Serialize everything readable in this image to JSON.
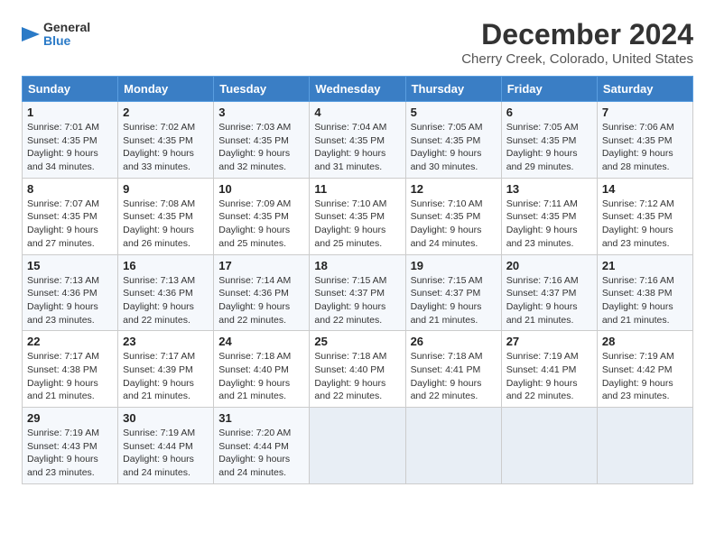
{
  "header": {
    "logo_general": "General",
    "logo_blue": "Blue",
    "title": "December 2024",
    "subtitle": "Cherry Creek, Colorado, United States"
  },
  "columns": [
    "Sunday",
    "Monday",
    "Tuesday",
    "Wednesday",
    "Thursday",
    "Friday",
    "Saturday"
  ],
  "weeks": [
    [
      {
        "day": "1",
        "info": "Sunrise: 7:01 AM\nSunset: 4:35 PM\nDaylight: 9 hours\nand 34 minutes."
      },
      {
        "day": "2",
        "info": "Sunrise: 7:02 AM\nSunset: 4:35 PM\nDaylight: 9 hours\nand 33 minutes."
      },
      {
        "day": "3",
        "info": "Sunrise: 7:03 AM\nSunset: 4:35 PM\nDaylight: 9 hours\nand 32 minutes."
      },
      {
        "day": "4",
        "info": "Sunrise: 7:04 AM\nSunset: 4:35 PM\nDaylight: 9 hours\nand 31 minutes."
      },
      {
        "day": "5",
        "info": "Sunrise: 7:05 AM\nSunset: 4:35 PM\nDaylight: 9 hours\nand 30 minutes."
      },
      {
        "day": "6",
        "info": "Sunrise: 7:05 AM\nSunset: 4:35 PM\nDaylight: 9 hours\nand 29 minutes."
      },
      {
        "day": "7",
        "info": "Sunrise: 7:06 AM\nSunset: 4:35 PM\nDaylight: 9 hours\nand 28 minutes."
      }
    ],
    [
      {
        "day": "8",
        "info": "Sunrise: 7:07 AM\nSunset: 4:35 PM\nDaylight: 9 hours\nand 27 minutes."
      },
      {
        "day": "9",
        "info": "Sunrise: 7:08 AM\nSunset: 4:35 PM\nDaylight: 9 hours\nand 26 minutes."
      },
      {
        "day": "10",
        "info": "Sunrise: 7:09 AM\nSunset: 4:35 PM\nDaylight: 9 hours\nand 25 minutes."
      },
      {
        "day": "11",
        "info": "Sunrise: 7:10 AM\nSunset: 4:35 PM\nDaylight: 9 hours\nand 25 minutes."
      },
      {
        "day": "12",
        "info": "Sunrise: 7:10 AM\nSunset: 4:35 PM\nDaylight: 9 hours\nand 24 minutes."
      },
      {
        "day": "13",
        "info": "Sunrise: 7:11 AM\nSunset: 4:35 PM\nDaylight: 9 hours\nand 23 minutes."
      },
      {
        "day": "14",
        "info": "Sunrise: 7:12 AM\nSunset: 4:35 PM\nDaylight: 9 hours\nand 23 minutes."
      }
    ],
    [
      {
        "day": "15",
        "info": "Sunrise: 7:13 AM\nSunset: 4:36 PM\nDaylight: 9 hours\nand 23 minutes."
      },
      {
        "day": "16",
        "info": "Sunrise: 7:13 AM\nSunset: 4:36 PM\nDaylight: 9 hours\nand 22 minutes."
      },
      {
        "day": "17",
        "info": "Sunrise: 7:14 AM\nSunset: 4:36 PM\nDaylight: 9 hours\nand 22 minutes."
      },
      {
        "day": "18",
        "info": "Sunrise: 7:15 AM\nSunset: 4:37 PM\nDaylight: 9 hours\nand 22 minutes."
      },
      {
        "day": "19",
        "info": "Sunrise: 7:15 AM\nSunset: 4:37 PM\nDaylight: 9 hours\nand 21 minutes."
      },
      {
        "day": "20",
        "info": "Sunrise: 7:16 AM\nSunset: 4:37 PM\nDaylight: 9 hours\nand 21 minutes."
      },
      {
        "day": "21",
        "info": "Sunrise: 7:16 AM\nSunset: 4:38 PM\nDaylight: 9 hours\nand 21 minutes."
      }
    ],
    [
      {
        "day": "22",
        "info": "Sunrise: 7:17 AM\nSunset: 4:38 PM\nDaylight: 9 hours\nand 21 minutes."
      },
      {
        "day": "23",
        "info": "Sunrise: 7:17 AM\nSunset: 4:39 PM\nDaylight: 9 hours\nand 21 minutes."
      },
      {
        "day": "24",
        "info": "Sunrise: 7:18 AM\nSunset: 4:40 PM\nDaylight: 9 hours\nand 21 minutes."
      },
      {
        "day": "25",
        "info": "Sunrise: 7:18 AM\nSunset: 4:40 PM\nDaylight: 9 hours\nand 22 minutes."
      },
      {
        "day": "26",
        "info": "Sunrise: 7:18 AM\nSunset: 4:41 PM\nDaylight: 9 hours\nand 22 minutes."
      },
      {
        "day": "27",
        "info": "Sunrise: 7:19 AM\nSunset: 4:41 PM\nDaylight: 9 hours\nand 22 minutes."
      },
      {
        "day": "28",
        "info": "Sunrise: 7:19 AM\nSunset: 4:42 PM\nDaylight: 9 hours\nand 23 minutes."
      }
    ],
    [
      {
        "day": "29",
        "info": "Sunrise: 7:19 AM\nSunset: 4:43 PM\nDaylight: 9 hours\nand 23 minutes."
      },
      {
        "day": "30",
        "info": "Sunrise: 7:19 AM\nSunset: 4:44 PM\nDaylight: 9 hours\nand 24 minutes."
      },
      {
        "day": "31",
        "info": "Sunrise: 7:20 AM\nSunset: 4:44 PM\nDaylight: 9 hours\nand 24 minutes."
      },
      {
        "day": "",
        "info": ""
      },
      {
        "day": "",
        "info": ""
      },
      {
        "day": "",
        "info": ""
      },
      {
        "day": "",
        "info": ""
      }
    ]
  ]
}
